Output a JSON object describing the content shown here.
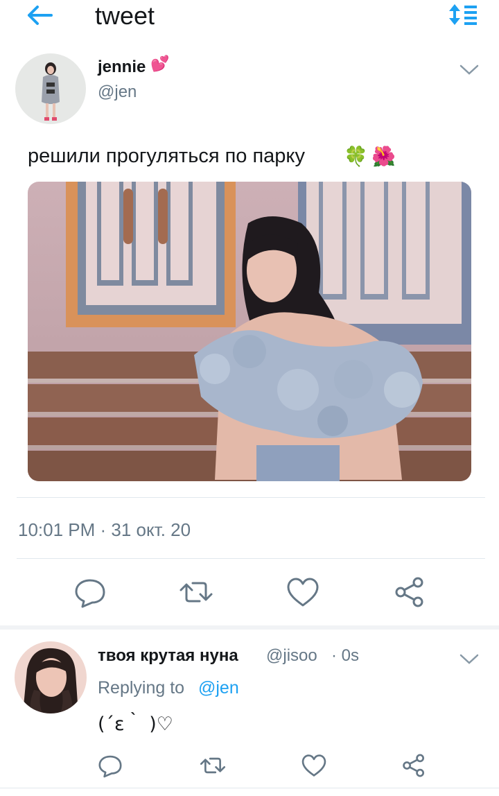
{
  "header": {
    "title": "tweet",
    "back_icon": "arrow-left-icon",
    "sort_icon": "sort-list-icon",
    "accent": "#1da1f2"
  },
  "tweet": {
    "author_name": "jennie",
    "author_emoji": "💕",
    "author_handle": "@jen",
    "text": "решили прогуляться по парку",
    "emojis": [
      "🍀",
      "🌺"
    ],
    "timestamp": "10:01 PM · 31 окт. 20",
    "actions": [
      "reply-icon",
      "retweet-icon",
      "like-icon",
      "share-icon"
    ]
  },
  "reply": {
    "author_name": "твоя крутая нуна",
    "author_handle": "@jisoo",
    "time": "· 0s",
    "replying_prefix": "Replying to",
    "replying_mention": "@jen",
    "text": "(´ε｀ )♡",
    "actions": [
      "reply-icon",
      "retweet-icon",
      "like-icon",
      "share-icon"
    ]
  },
  "colors": {
    "text_primary": "#14171a",
    "text_secondary": "#657786",
    "divider": "#e1e8ed",
    "link": "#1da1f2"
  }
}
